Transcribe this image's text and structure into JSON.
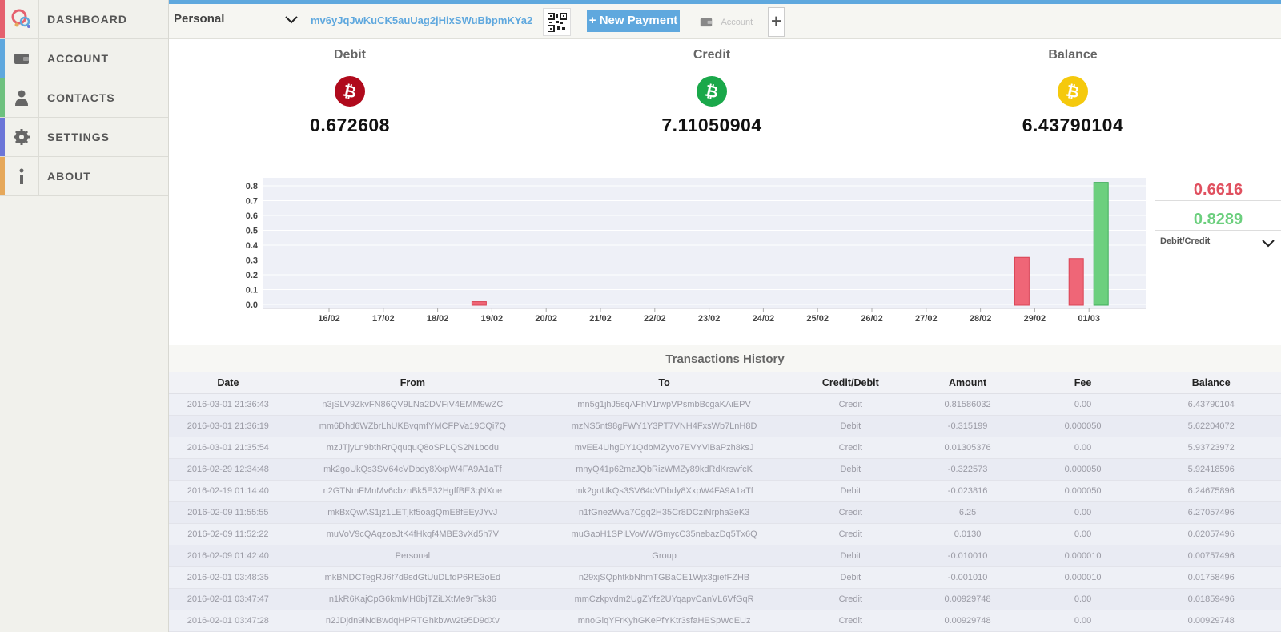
{
  "sidebar": {
    "items": [
      {
        "label": "DASHBOARD",
        "icon": "logo-circles-icon",
        "color": "#e5616e"
      },
      {
        "label": "ACCOUNT",
        "icon": "wallet-icon",
        "color": "#5fa8de"
      },
      {
        "label": "CONTACTS",
        "icon": "user-icon",
        "color": "#6ec17f"
      },
      {
        "label": "SETTINGS",
        "icon": "gear-icon",
        "color": "#6c76d8"
      },
      {
        "label": "ABOUT",
        "icon": "info-icon",
        "color": "#e6a85a"
      }
    ]
  },
  "topbar": {
    "wallet_select": "Personal",
    "address": "mv6yJqJwKuCK5auUag2jHixSWuBbpmKYa2",
    "new_payment": "+ New Payment",
    "account_label": "Account",
    "add_label": "+"
  },
  "summary": {
    "debit": {
      "label": "Debit",
      "value": "0.672608",
      "color": "#b00a1c"
    },
    "credit": {
      "label": "Credit",
      "value": "7.11050904",
      "color": "#1aa84a"
    },
    "balance": {
      "label": "Balance",
      "value": "6.43790104",
      "color": "#f1c40f"
    }
  },
  "chart_data": {
    "type": "bar",
    "categories": [
      "16/02",
      "17/02",
      "18/02",
      "19/02",
      "20/02",
      "21/02",
      "22/02",
      "23/02",
      "24/02",
      "25/02",
      "26/02",
      "27/02",
      "28/02",
      "29/02",
      "01/03"
    ],
    "series": [
      {
        "values": [
          0,
          0,
          0,
          0.024,
          0,
          0,
          0,
          0,
          0,
          0,
          0,
          0,
          0,
          0.323,
          0.315
        ]
      },
      {
        "values": [
          0,
          0,
          0,
          0,
          0,
          0,
          0,
          0,
          0,
          0,
          0,
          0,
          0,
          0,
          0.829
        ]
      }
    ],
    "yticks": [
      "0.0",
      "0.1",
      "0.2",
      "0.3",
      "0.4",
      "0.5",
      "0.6",
      "0.7",
      "0.8"
    ],
    "ylim": [
      0,
      0.85
    ],
    "colors": {
      "debit": "#ef6677",
      "credit": "#6ccf7e"
    }
  },
  "chart_side": {
    "debit_total": "0.6616",
    "credit_total": "0.8289",
    "selector": "Debit/Credit"
  },
  "transactions": {
    "title": "Transactions History",
    "headers": [
      "Date",
      "From",
      "To",
      "Credit/Debit",
      "Amount",
      "Fee",
      "Balance"
    ],
    "rows": [
      [
        "2016-03-01 21:36:43",
        "n3jSLV9ZkvFN86QV9LNa2DVFiV4EMM9wZC",
        "mn5g1jhJ5sqAFhV1rwpVPsmbBcgaKAiEPV",
        "Credit",
        "0.81586032",
        "0.00",
        "6.43790104"
      ],
      [
        "2016-03-01 21:36:19",
        "mm6Dhd6WZbrLhUKBvqmfYMCFPVa19CQi7Q",
        "mzNS5nt98gFWY1Y3PT7VNH4FxsWb7LnH8D",
        "Debit",
        "-0.315199",
        "0.000050",
        "5.62204072"
      ],
      [
        "2016-03-01 21:35:54",
        "mzJTjyLn9bthRrQququQ8oSPLQS2N1bodu",
        "mvEE4UhgDY1QdbMZyvo7EVYViBaPzh8ksJ",
        "Credit",
        "0.01305376",
        "0.00",
        "5.93723972"
      ],
      [
        "2016-02-29 12:34:48",
        "mk2goUkQs3SV64cVDbdy8XxpW4FA9A1aTf",
        "mnyQ41p62mzJQbRizWMZy89kdRdKrswfcK",
        "Debit",
        "-0.322573",
        "0.000050",
        "5.92418596"
      ],
      [
        "2016-02-19 01:14:40",
        "n2GTNmFMnMv6cbznBk5E32HgffBE3qNXoe",
        "mk2goUkQs3SV64cVDbdy8XxpW4FA9A1aTf",
        "Debit",
        "-0.023816",
        "0.000050",
        "6.24675896"
      ],
      [
        "2016-02-09 11:55:55",
        "mkBxQwAS1jz1LETjkf5oagQmE8fEEyJYvJ",
        "n1fGnezWva7Cgq2H35Cr8DCziNrpha3eK3",
        "Credit",
        "6.25",
        "0.00",
        "6.27057496"
      ],
      [
        "2016-02-09 11:52:22",
        "muVoV9cQAqzoeJtK4fHkqf4MBE3vXd5h7V",
        "muGaoH1SPiLVoWWGmycC35nebazDq5Tx6Q",
        "Credit",
        "0.0130",
        "0.00",
        "0.02057496"
      ],
      [
        "2016-02-09 01:42:40",
        "Personal",
        "Group",
        "Debit",
        "-0.010010",
        "0.000010",
        "0.00757496"
      ],
      [
        "2016-02-01 03:48:35",
        "mkBNDCTegRJ6f7d9sdGtUuDLfdP6RE3oEd",
        "n29xjSQphtkbNhmTGBaCE1Wjx3giefFZHB",
        "Debit",
        "-0.001010",
        "0.000010",
        "0.01758496"
      ],
      [
        "2016-02-01 03:47:47",
        "n1kR6KajCpG6kmMH6bjTZiLXtMe9rTsk36",
        "mmCzkpvdm2UgZYfz2UYqapvCanVL6VfGqR",
        "Credit",
        "0.00929748",
        "0.00",
        "0.01859496"
      ],
      [
        "2016-02-01 03:47:28",
        "n2JDjdn9iNdBwdqHPRTGhkbww2t95D9dXv",
        "mnoGiqYFrKyhGKePfYKtr3sfaHESpWdEUz",
        "Credit",
        "0.00929748",
        "0.00",
        "0.00929748"
      ]
    ]
  }
}
